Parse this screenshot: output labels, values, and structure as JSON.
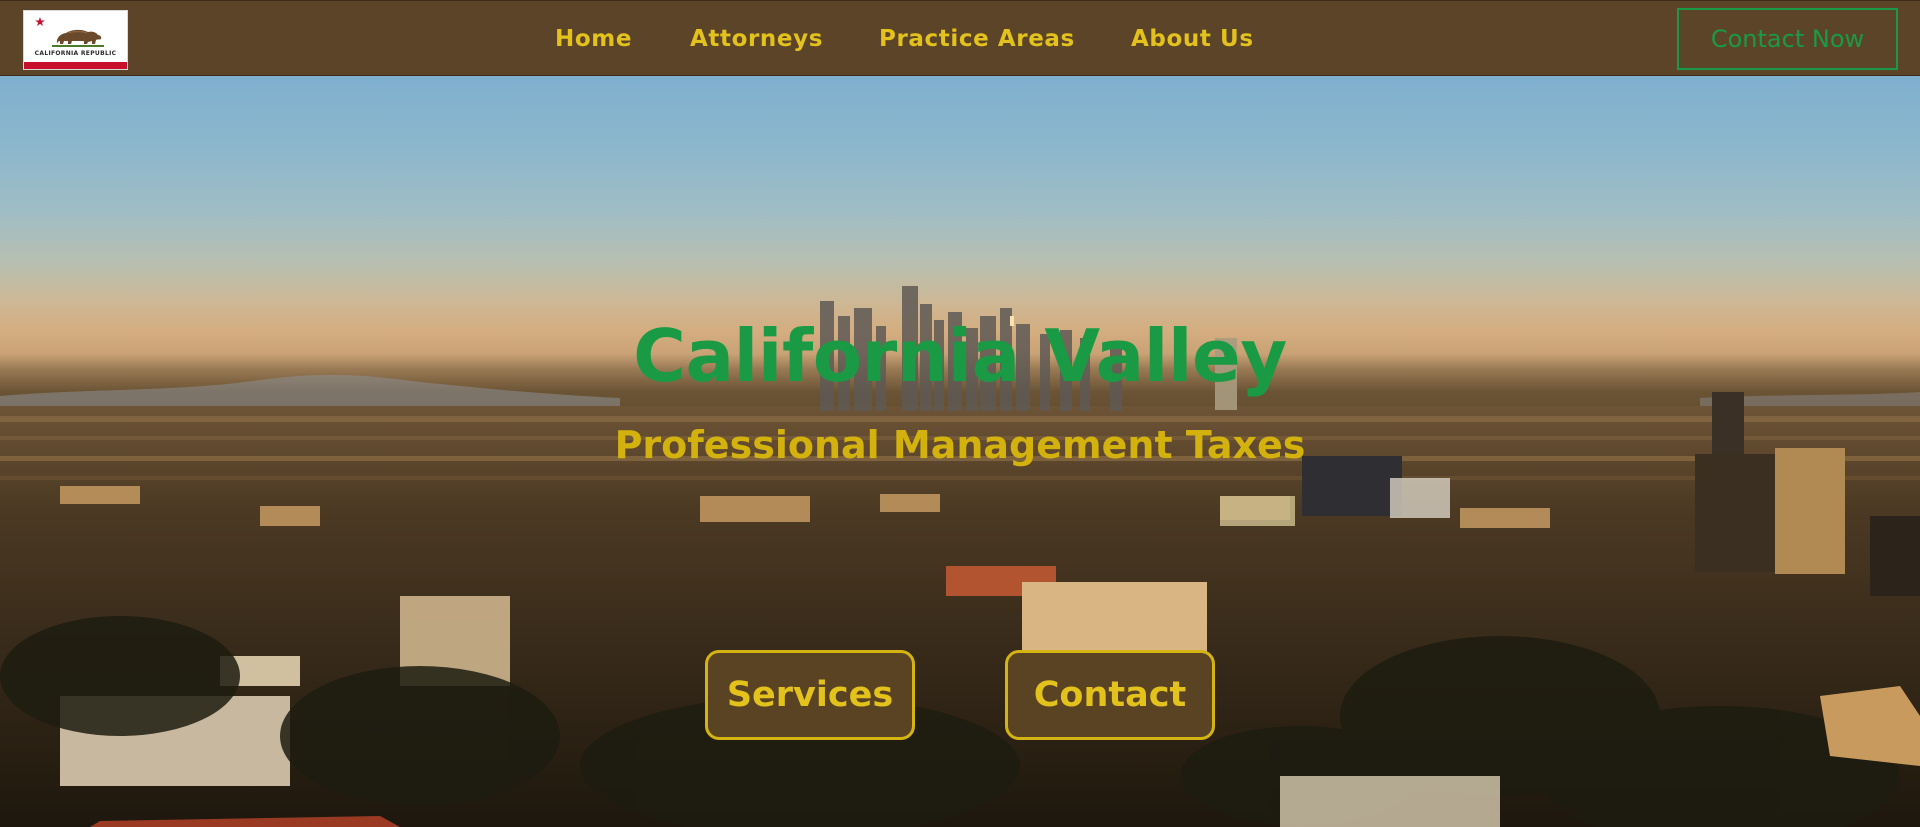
{
  "logo": {
    "text": "CALIFORNIA REPUBLIC",
    "icon": "california-flag-icon"
  },
  "nav": {
    "items": [
      {
        "label": "Home"
      },
      {
        "label": "Attorneys"
      },
      {
        "label": "Practice Areas"
      },
      {
        "label": "About Us"
      }
    ],
    "cta_label": "Contact Now"
  },
  "hero": {
    "title": "California Valley",
    "subtitle": "Professional Management Taxes",
    "buttons": [
      {
        "label": "Services"
      },
      {
        "label": "Contact"
      }
    ]
  },
  "colors": {
    "navbar_bg": "#5c4428",
    "nav_text": "#e3c21c",
    "accent_green": "#1a9a44",
    "button_bg": "#5a4322",
    "button_border": "#d4b312"
  }
}
